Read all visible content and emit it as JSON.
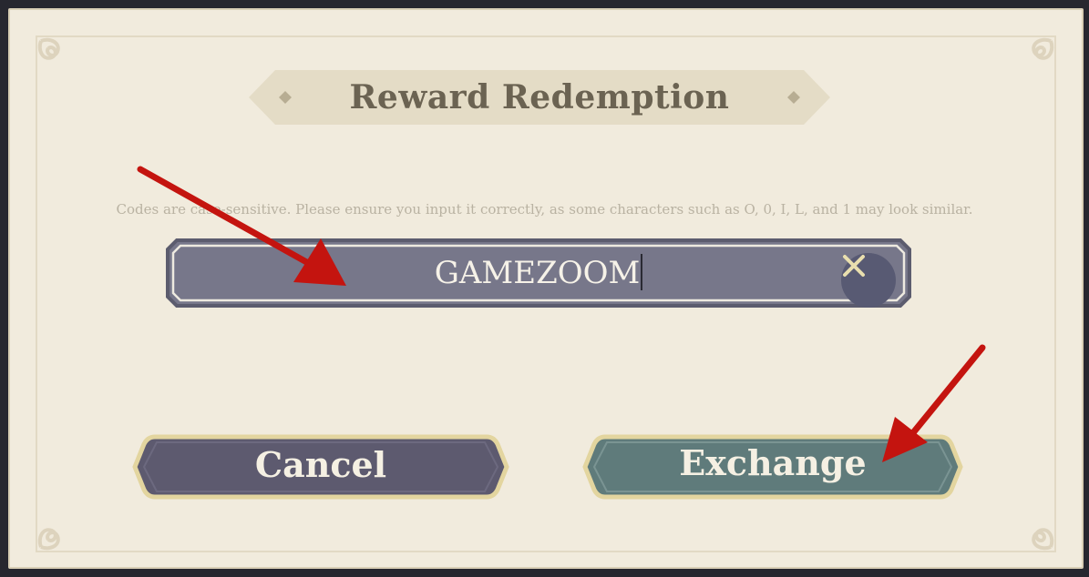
{
  "dialog": {
    "title": "Reward Redemption",
    "hint": "Codes are case-sensitive. Please ensure you input it correctly, as some characters such as O, 0, I, L, and 1 may look similar.",
    "code_input": {
      "value": "GAMEZOOM",
      "clear_icon": "close-x-icon"
    },
    "buttons": {
      "cancel_label": "Cancel",
      "exchange_label": "Exchange"
    }
  },
  "colors": {
    "panel_bg": "#f1ebdd",
    "input_bg": "#77778a",
    "cancel_bg": "#5d5a6f",
    "exchange_bg": "#5f7b7b",
    "gold_trim": "#e3d59f",
    "annotation_arrow": "#c4140f"
  }
}
